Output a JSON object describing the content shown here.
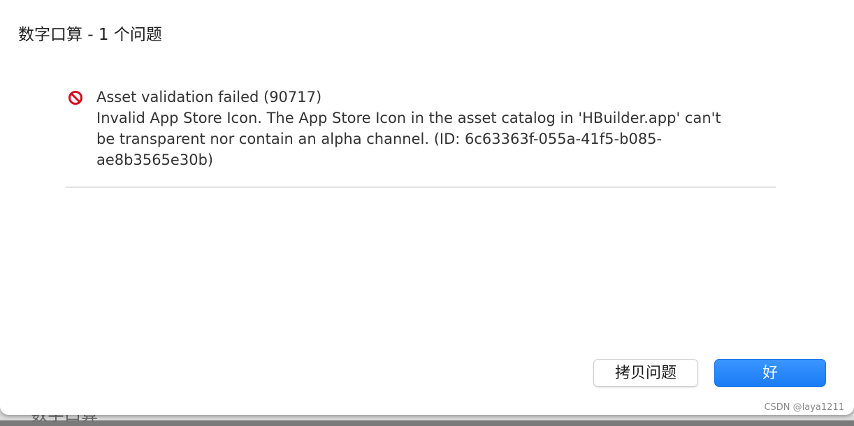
{
  "backdrop": {
    "window_title": "数字口算"
  },
  "dialog": {
    "title": "数字口算 - 1 个问题",
    "issue": {
      "icon": "prohibited-icon",
      "icon_color": "#d40b1f",
      "heading": "Asset validation failed (90717)",
      "message_lines": [
        "Invalid App Store Icon. The App Store Icon in the asset catalog in 'HBuilder.app' can't",
        "be transparent nor contain an alpha channel. (ID: 6c63363f-055a-41f5-b085-",
        "ae8b3565e30b)"
      ]
    },
    "buttons": {
      "copy_label": "拷贝问题",
      "ok_label": "好",
      "ok_color": "#1a7cf5"
    }
  },
  "watermark": "CSDN @laya1211"
}
